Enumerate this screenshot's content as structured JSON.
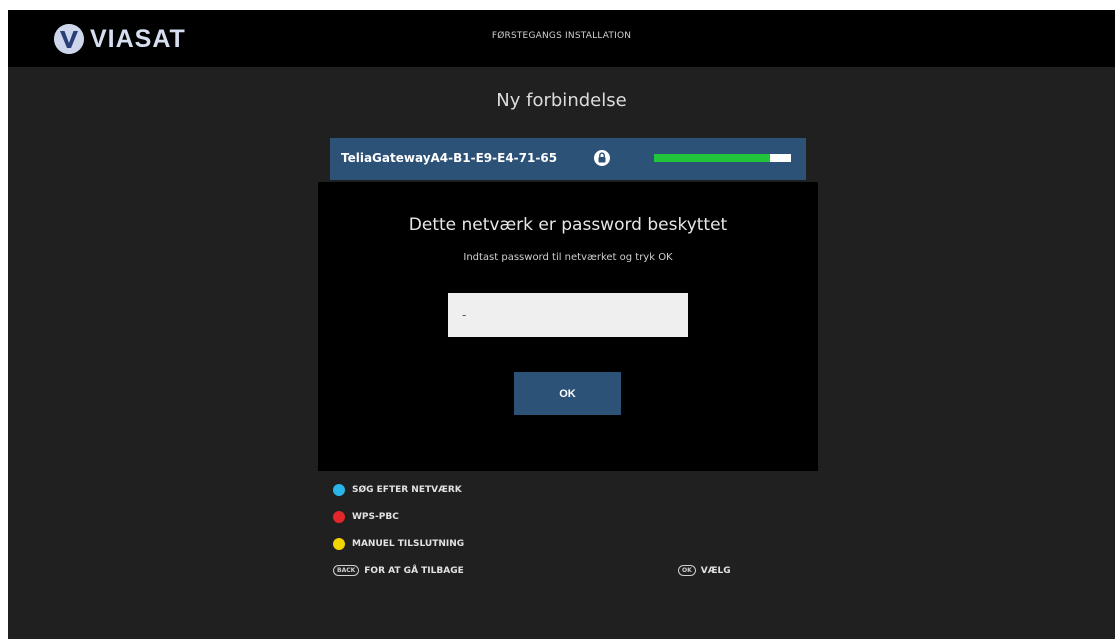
{
  "header": {
    "logo_text": "VIASAT",
    "title": "FØRSTEGANGS INSTALLATION"
  },
  "page": {
    "title": "Ny forbindelse"
  },
  "network": {
    "name": "TeliaGatewayA4-B1-E9-E4-71-65",
    "locked_icon": "lock-icon",
    "signal_strength": 0.85,
    "signal_color": "#22c43a"
  },
  "dialog": {
    "title": "Dette netværk er password beskyttet",
    "subtitle": "Indtast password til netværket og tryk OK",
    "password_value": "-",
    "ok_label": "OK"
  },
  "options": [
    {
      "label": "SØG EFTER NETVÆRK",
      "color": "#29b6e6",
      "icon": "blue-button-icon"
    },
    {
      "label": "WPS-PBC",
      "color": "#e3262b",
      "icon": "red-button-icon"
    },
    {
      "label": "MANUEL TILSLUTNING",
      "color": "#f2d400",
      "icon": "yellow-button-icon"
    }
  ],
  "hints": {
    "back_key": "BACK",
    "back_label": "FOR AT GÅ TILBAGE",
    "ok_key": "OK",
    "ok_label": "VÆLG"
  },
  "colors": {
    "accent_blue": "#2d5278",
    "background": "#202020",
    "dialog_background": "#000000"
  }
}
